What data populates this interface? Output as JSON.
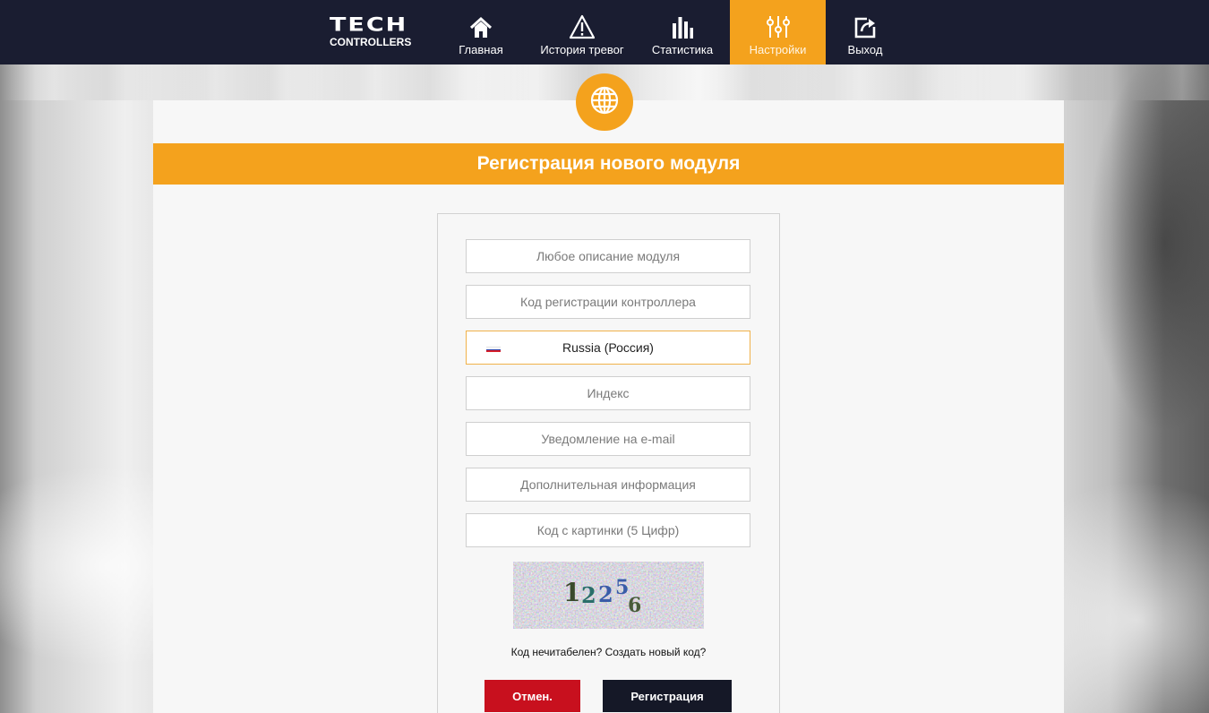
{
  "app": {
    "logo_mark": "TECH",
    "logo_sub": "CONTROLLERS"
  },
  "nav": {
    "items": [
      {
        "label": "Главная",
        "icon": "home-icon",
        "active": false
      },
      {
        "label": "История тревог",
        "icon": "warning-icon",
        "active": false
      },
      {
        "label": "Статистика",
        "icon": "statistics-icon",
        "active": false
      },
      {
        "label": "Настройки",
        "icon": "sliders-icon",
        "active": true
      },
      {
        "label": "Выход",
        "icon": "exit-icon",
        "active": false
      }
    ]
  },
  "page": {
    "title": "Регистрация нового модуля",
    "badge_icon": "globe-icon"
  },
  "form": {
    "description_placeholder": "Любое описание модуля",
    "description_value": "",
    "reg_code_placeholder": "Код регистрации контроллера",
    "reg_code_value": "",
    "country": {
      "selected": "Russia (Россия)",
      "flag_icon": "russia-flag-icon"
    },
    "index_placeholder": "Индекс",
    "index_value": "",
    "email_placeholder": "Уведомление на e-mail",
    "email_value": "",
    "extra_placeholder": "Дополнительная информация",
    "extra_value": "",
    "captcha_placeholder": "Код с картинки (5 Цифр)",
    "captcha_value": "",
    "captcha_text": "12256",
    "captcha_refresh": "Код нечитабелен? Создать новый код?",
    "cancel_label": "Отмен.",
    "register_label": "Регистрация"
  },
  "colors": {
    "accent": "#f4a21d",
    "topbar": "#1a1d31",
    "cancel": "#c8101e",
    "register": "#151827"
  }
}
